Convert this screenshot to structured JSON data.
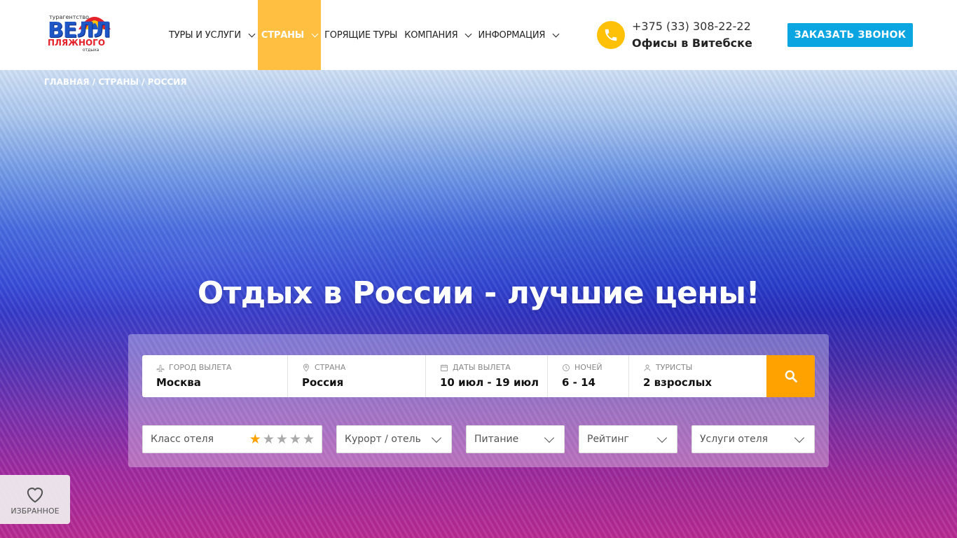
{
  "logo": {
    "small_text": "турагентство",
    "main_text": "ВЕЛЛ",
    "sub_text": "ПЛЯЖНОГО",
    "tiny_text": "отдыха"
  },
  "nav": {
    "items": [
      {
        "label": "Туры и услуги",
        "has_dropdown": true,
        "active": false
      },
      {
        "label": "Страны",
        "has_dropdown": true,
        "active": true
      },
      {
        "label": "Горящие туры",
        "has_dropdown": false,
        "active": false
      },
      {
        "label": "Компания",
        "has_dropdown": true,
        "active": false
      },
      {
        "label": "Информация",
        "has_dropdown": true,
        "active": false
      }
    ]
  },
  "contact": {
    "phone": "+375 (33) 308-22-22",
    "offices": "Офисы в Витебске"
  },
  "header": {
    "callback_label": "Заказать звонок"
  },
  "breadcrumb": {
    "home": "Главная",
    "sep1": " / ",
    "countries": "Страны",
    "sep2": " / ",
    "current": "Россия"
  },
  "hero": {
    "title": "Отдых в России - лучшие цены!"
  },
  "search": {
    "fields": [
      {
        "label": "Город вылета",
        "value": "Москва",
        "icon": "plane-icon"
      },
      {
        "label": "Страна",
        "value": "Россия",
        "icon": "location-pin-icon"
      },
      {
        "label": "Даты вылета",
        "value": "10 июл - 19 июл",
        "icon": "calendar-icon"
      },
      {
        "label": "Ночей",
        "value": "6 - 14",
        "icon": "clock-icon"
      },
      {
        "label": "Туристы",
        "value": "2 взрослых",
        "icon": "user-icon"
      }
    ]
  },
  "filters": {
    "hotel_class": {
      "label": "Класс отеля",
      "stars_selected": 1,
      "stars_total": 5
    },
    "resort": {
      "placeholder": "Курорт / отель"
    },
    "meal": {
      "placeholder": "Питание"
    },
    "rating": {
      "placeholder": "Рейтинг"
    },
    "services": {
      "placeholder": "Услуги отеля"
    }
  },
  "favorites": {
    "label": "Избранное"
  },
  "colors": {
    "accent": "#ffc042",
    "search_button": "#ffa200",
    "callback_button": "#0ba5e2",
    "phone_icon": "#ffc107"
  }
}
